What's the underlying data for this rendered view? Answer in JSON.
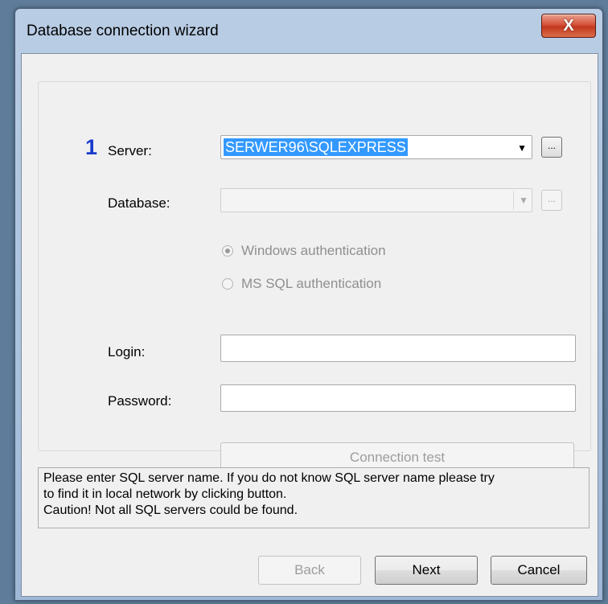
{
  "window": {
    "title": "Database connection wizard",
    "close_glyph": "X"
  },
  "form": {
    "step_number": "1",
    "server_label": "Server:",
    "server_value": "SERWER96\\SQLEXPRESS",
    "database_label": "Database:",
    "database_value": "",
    "browse_label": "...",
    "auth_windows_label": "Windows authentication",
    "auth_windows_selected": true,
    "auth_sql_label": "MS SQL authentication",
    "auth_sql_selected": false,
    "login_label": "Login:",
    "login_value": "",
    "password_label": "Password:",
    "password_value": "",
    "connection_test_label": "Connection test"
  },
  "info": {
    "lines": [
      "Please enter SQL server name. If you do not know SQL server name please try",
      "to find it in local network by clicking button.",
      "Caution! Not all SQL servers could be found."
    ]
  },
  "footer": {
    "back_label": "Back",
    "next_label": "Next",
    "cancel_label": "Cancel"
  },
  "icons": {
    "dropdown_arrow": "chevron-down-icon",
    "close": "close-icon"
  },
  "colors": {
    "step_number": "#1a3ccd",
    "selection": "#3399ff",
    "close_button": "#c2391f",
    "dialog_background": "#f0f0f0"
  }
}
